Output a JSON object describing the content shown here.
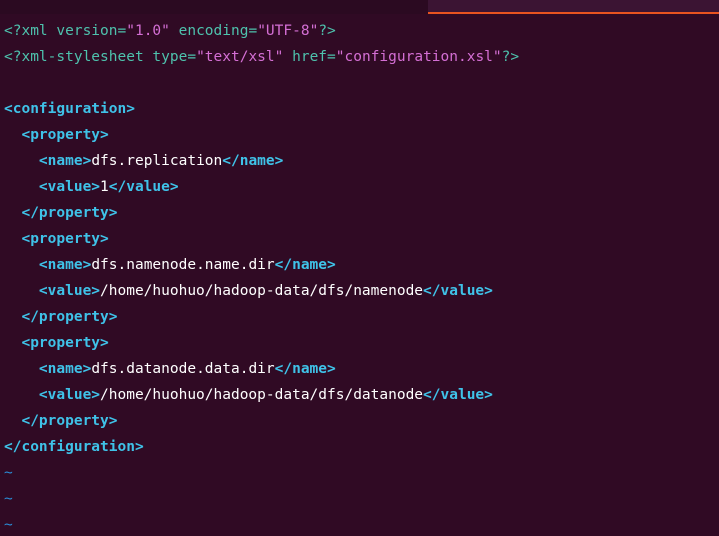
{
  "theme": {
    "background": "#300a24",
    "tag_color": "#3fc2e8",
    "string_color": "#d46fd4",
    "decl_color": "#4ec2ad",
    "tilde_color": "#2a8bd4",
    "tab_accent": "#e95420"
  },
  "editor": {
    "xml_decl": {
      "open": "<?xml",
      "version_attr": " version=",
      "version_val": "\"1.0\"",
      "encoding_attr": " encoding=",
      "encoding_val": "\"UTF-8\"",
      "close": "?>"
    },
    "stylesheet_pi": {
      "open": "<?xml-stylesheet",
      "type_attr": " type=",
      "type_val": "\"text/xsl\"",
      "href_attr": " href=",
      "href_val": "\"configuration.xsl\"",
      "close": "?>"
    },
    "configuration_open": "<configuration>",
    "configuration_close": "</configuration>",
    "property_open": "<property>",
    "property_close": "</property>",
    "name_open": "<name>",
    "name_close": "</name>",
    "value_open": "<value>",
    "value_close": "</value>",
    "properties": [
      {
        "name": "dfs.replication",
        "value": "1"
      },
      {
        "name": "dfs.namenode.name.dir",
        "value": "/home/huohuo/hadoop-data/dfs/namenode"
      },
      {
        "name": "dfs.datanode.data.dir",
        "value": "/home/huohuo/hadoop-data/dfs/datanode"
      }
    ],
    "empty_line_marker": "~"
  }
}
